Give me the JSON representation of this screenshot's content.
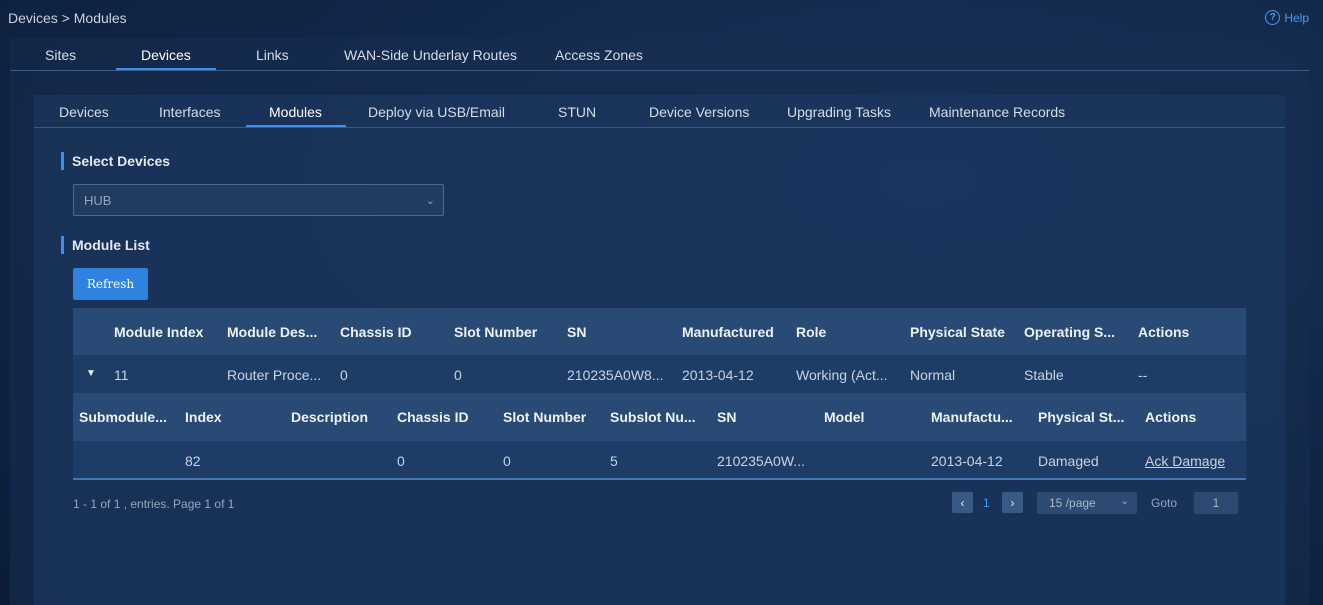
{
  "breadcrumb": "Devices > Modules",
  "help_label": "Help",
  "top_tabs": [
    "Sites",
    "Devices",
    "Links",
    "WAN-Side Underlay Routes",
    "Access Zones"
  ],
  "sub_tabs": [
    "Devices",
    "Interfaces",
    "Modules",
    "Deploy via USB/Email",
    "STUN",
    "Device Versions",
    "Upgrading Tasks",
    "Maintenance Records"
  ],
  "select_devices": {
    "title": "Select Devices",
    "value": "HUB"
  },
  "module_list": {
    "title": "Module List",
    "refresh_label": "Refresh",
    "columns": [
      "Module Index",
      "Module Des...",
      "Chassis ID",
      "Slot Number",
      "SN",
      "Manufactured",
      "Role",
      "Physical State",
      "Operating S...",
      "Actions"
    ],
    "row": [
      "11",
      "Router Proce...",
      "0",
      "0",
      "210235A0W8...",
      "2013-04-12",
      "Working (Act...",
      "Normal",
      "Stable",
      "--"
    ],
    "sub_columns": [
      "Submodule...",
      "Index",
      "Description",
      "Chassis ID",
      "Slot Number",
      "Subslot Nu...",
      "SN",
      "Model",
      "Manufactu...",
      "Physical St...",
      "Actions"
    ],
    "sub_row": [
      "",
      "82",
      "",
      "0",
      "0",
      "5",
      "210235A0W...",
      "",
      "2013-04-12",
      "Damaged",
      "Ack Damage"
    ]
  },
  "pagination": {
    "summary": "1 - 1 of 1 , entries. Page 1 of 1",
    "prev": "‹",
    "next": "›",
    "current_page": "1",
    "per_page": "15 /page",
    "goto_label": "Goto",
    "goto_value": "1"
  }
}
